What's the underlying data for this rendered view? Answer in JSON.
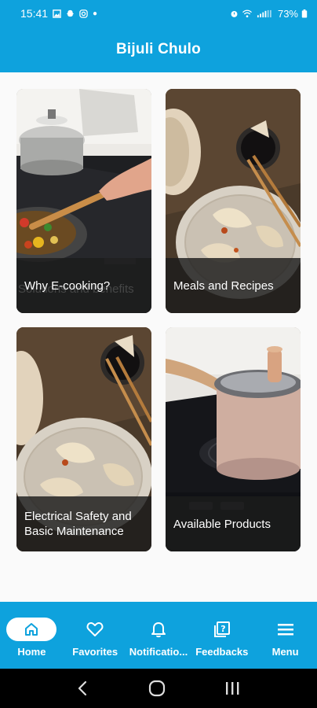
{
  "status_bar": {
    "time": "15:41",
    "battery": "73%"
  },
  "app_bar": {
    "title": "Bijuli Chulo"
  },
  "cards": [
    {
      "label": "Why E-cooking?",
      "ghost": "Solutions and benefits"
    },
    {
      "label": "Meals and Recipes"
    },
    {
      "label": "Electrical Safety and Basic Maintenance"
    },
    {
      "label": "Available Products"
    }
  ],
  "bottom_nav": {
    "items": [
      {
        "label": "Home",
        "icon": "home-icon",
        "active": true
      },
      {
        "label": "Favorites",
        "icon": "heart-icon",
        "active": false
      },
      {
        "label": "Notificatio...",
        "icon": "bell-icon",
        "active": false
      },
      {
        "label": "Feedbacks",
        "icon": "feedback-icon",
        "active": false
      },
      {
        "label": "Menu",
        "icon": "menu-icon",
        "active": false
      }
    ]
  },
  "colors": {
    "primary": "#0ea2dd",
    "background": "#fafafa",
    "label_overlay": "#1c1c1c"
  }
}
